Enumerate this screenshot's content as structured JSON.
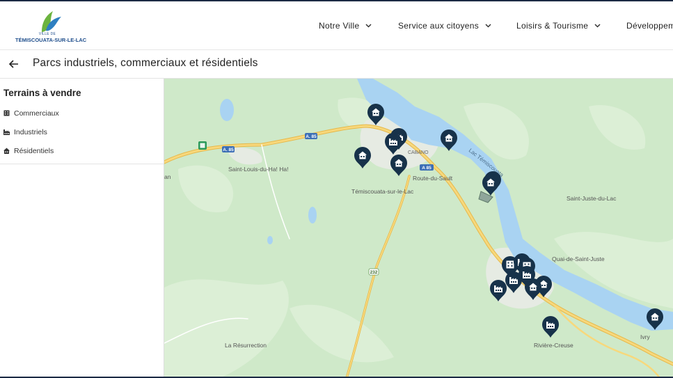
{
  "header": {
    "logo": {
      "small_text": "VILLE DE",
      "name": "TÉMISCOUATA-SUR-LE-LAC",
      "icon": "leaf-logo"
    },
    "nav": [
      {
        "label": "Notre Ville",
        "icon": "chevron-down-icon"
      },
      {
        "label": "Service aux citoyens",
        "icon": "chevron-down-icon"
      },
      {
        "label": "Loisirs & Tourisme",
        "icon": "chevron-down-icon"
      },
      {
        "label": "Développem"
      }
    ]
  },
  "page": {
    "title": "Parcs industriels, commerciaux et résidentiels",
    "back_icon": "arrow-left-icon"
  },
  "sidebar": {
    "title": "Terrains à vendre",
    "items": [
      {
        "label": "Commerciaux",
        "icon": "building-icon"
      },
      {
        "label": "Industriels",
        "icon": "factory-icon"
      },
      {
        "label": "Résidentiels",
        "icon": "house-icon"
      }
    ]
  },
  "map": {
    "colors": {
      "land": "#cfe9c9",
      "water": "#a9d3f2",
      "highway": "#f3cc66",
      "marker": "#17324a"
    },
    "places": [
      "Saint-Louis-du-Ha! Ha!",
      "Témiscouata-sur-le-Lac",
      "Route-du-Sault",
      "Saint-Juste-du-Lac",
      "Quai-de-Saint-Juste",
      "La Résurrection",
      "Rivière-Creuse",
      "Ivry",
      "Lac Témiscouata",
      "CABANO",
      "an"
    ],
    "shields": [
      "A. 85",
      "A. 85",
      "A 85",
      "232"
    ],
    "markers": [
      {
        "type": "residential"
      },
      {
        "type": "industrial"
      },
      {
        "type": "industrial"
      },
      {
        "type": "residential"
      },
      {
        "type": "residential"
      },
      {
        "type": "residential"
      },
      {
        "type": "residential"
      },
      {
        "type": "residential"
      },
      {
        "type": "commercial"
      },
      {
        "type": "industrial"
      },
      {
        "type": "commercial"
      },
      {
        "type": "industrial"
      },
      {
        "type": "industrial"
      },
      {
        "type": "residential"
      },
      {
        "type": "industrial"
      },
      {
        "type": "residential"
      },
      {
        "type": "industrial"
      },
      {
        "type": "residential"
      }
    ]
  }
}
